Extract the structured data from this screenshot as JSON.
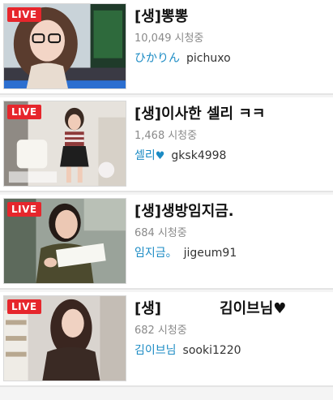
{
  "live_badge": "LIVE",
  "viewers_suffix": "시청중",
  "colors": {
    "live_badge": "#e6262c",
    "nickname": "#1b8bc4",
    "viewers": "#8a8a8a",
    "title": "#111111"
  },
  "items": [
    {
      "title": "[생]뽕뽕",
      "viewers": "10,049",
      "nickname": "ひかりん",
      "user_id": "pichuxo",
      "thumbnail_icon": "webcam-thumbnail-icon"
    },
    {
      "title": "[생]이사한 셀리 ㅋㅋ",
      "viewers": "1,468",
      "nickname": "셀리",
      "nickname_icon": "heart-icon",
      "user_id": "gksk4998",
      "thumbnail_icon": "webcam-thumbnail-icon"
    },
    {
      "title": "[생]생방임지금.",
      "viewers": "684",
      "nickname": "임지금。",
      "user_id": "jigeum91",
      "thumbnail_icon": "webcam-thumbnail-icon"
    },
    {
      "title_left": "[생]",
      "title_right": "김이브님♥",
      "viewers": "682",
      "nickname": "김이브님",
      "user_id": "sooki1220",
      "thumbnail_icon": "webcam-thumbnail-icon"
    }
  ]
}
